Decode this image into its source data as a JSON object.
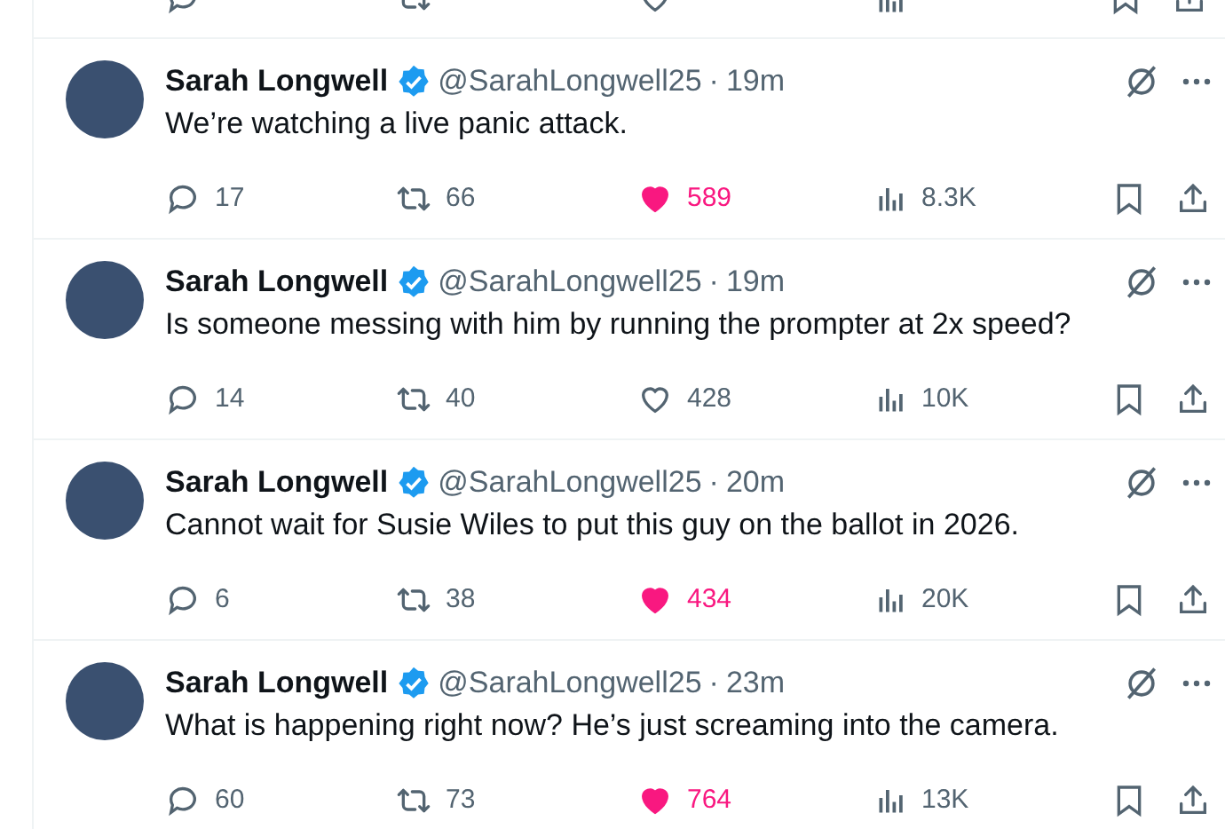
{
  "tweets": [
    {
      "name": "Sarah Longwell",
      "handle": "@SarahLongwell25",
      "sep": "·",
      "time": "19m",
      "text": "We’re watching a live panic attack.",
      "replies": "17",
      "reposts": "66",
      "likes": "589",
      "liked": true,
      "views": "8.3K"
    },
    {
      "name": "Sarah Longwell",
      "handle": "@SarahLongwell25",
      "sep": "·",
      "time": "19m",
      "text": "Is someone messing with him by running the prompter at 2x speed?",
      "replies": "14",
      "reposts": "40",
      "likes": "428",
      "liked": false,
      "views": "10K"
    },
    {
      "name": "Sarah Longwell",
      "handle": "@SarahLongwell25",
      "sep": "·",
      "time": "20m",
      "text": "Cannot wait for Susie Wiles to put this guy on the ballot in 2026.",
      "replies": "6",
      "reposts": "38",
      "likes": "434",
      "liked": true,
      "views": "20K"
    },
    {
      "name": "Sarah Longwell",
      "handle": "@SarahLongwell25",
      "sep": "·",
      "time": "23m",
      "text": "What is happening right now? He’s just screaming into the camera.",
      "replies": "60",
      "reposts": "73",
      "likes": "764",
      "liked": true,
      "views": "13K"
    }
  ]
}
